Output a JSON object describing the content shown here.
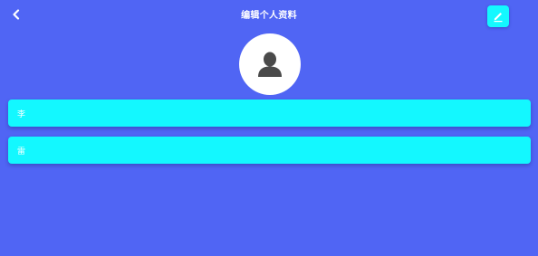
{
  "header": {
    "title": "编辑个人资料",
    "back_icon": "chevron-left-icon",
    "edit_icon": "pencil-icon"
  },
  "avatar": {
    "icon": "user-silhouette-icon"
  },
  "form": {
    "first_name_value": "李",
    "last_name_value": "雷"
  },
  "colors": {
    "background": "#5065f4",
    "accent": "#13f8ff",
    "avatar_background": "#ffffff",
    "avatar_icon": "#4a4a4a",
    "text": "#ffffff"
  }
}
